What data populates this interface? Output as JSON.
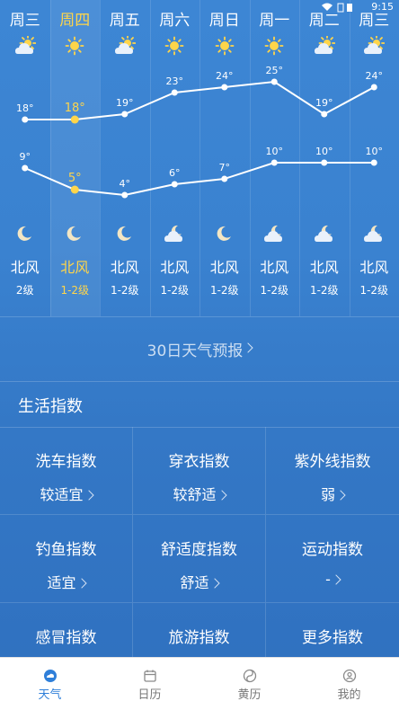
{
  "status": {
    "time": "9:15"
  },
  "days": [
    {
      "name": "周三",
      "day_icon": "cloudy-sun-icon",
      "high": "18°",
      "low": "9°",
      "night_icon": "moon-icon",
      "wind_dir": "北风",
      "wind_level": "2级",
      "today": false
    },
    {
      "name": "周四",
      "day_icon": "sun-icon",
      "high": "18°",
      "low": "5°",
      "night_icon": "moon-icon",
      "wind_dir": "北风",
      "wind_level": "1-2级",
      "today": true
    },
    {
      "name": "周五",
      "day_icon": "cloudy-sun-icon",
      "high": "19°",
      "low": "4°",
      "night_icon": "moon-icon",
      "wind_dir": "北风",
      "wind_level": "1-2级",
      "today": false
    },
    {
      "name": "周六",
      "day_icon": "sun-icon",
      "high": "23°",
      "low": "6°",
      "night_icon": "cloudy-moon-icon",
      "wind_dir": "北风",
      "wind_level": "1-2级",
      "today": false
    },
    {
      "name": "周日",
      "day_icon": "sun-icon",
      "high": "24°",
      "low": "7°",
      "night_icon": "moon-icon",
      "wind_dir": "北风",
      "wind_level": "1-2级",
      "today": false
    },
    {
      "name": "周一",
      "day_icon": "sun-icon",
      "high": "25°",
      "low": "10°",
      "night_icon": "cloudy-moon-icon",
      "wind_dir": "北风",
      "wind_level": "1-2级",
      "today": false
    },
    {
      "name": "周二",
      "day_icon": "cloudy-sun-icon",
      "high": "19°",
      "low": "10°",
      "night_icon": "cloudy-moon-icon",
      "wind_dir": "北风",
      "wind_level": "1-2级",
      "today": false
    },
    {
      "name": "周三",
      "day_icon": "cloudy-sun-icon",
      "high": "24°",
      "low": "10°",
      "night_icon": "cloudy-moon-icon",
      "wind_dir": "北风",
      "wind_level": "1-2级",
      "today": false
    }
  ],
  "chart_data": {
    "type": "line",
    "categories": [
      "周三",
      "周四",
      "周五",
      "周六",
      "周日",
      "周一",
      "周二",
      "周三"
    ],
    "series": [
      {
        "values": [
          18,
          18,
          19,
          23,
          24,
          25,
          19,
          24
        ]
      },
      {
        "values": [
          9,
          5,
          4,
          6,
          7,
          10,
          10,
          10
        ]
      }
    ],
    "highlight_index": 1,
    "highlight_color": "#ffd54a",
    "line_color": "#ffffff"
  },
  "forecast30": {
    "label": "30日天气预报"
  },
  "life": {
    "title": "生活指数",
    "items": [
      {
        "name": "洗车指数",
        "value": "较适宜"
      },
      {
        "name": "穿衣指数",
        "value": "较舒适"
      },
      {
        "name": "紫外线指数",
        "value": "弱"
      },
      {
        "name": "钓鱼指数",
        "value": "适宜"
      },
      {
        "name": "舒适度指数",
        "value": "舒适"
      },
      {
        "name": "运动指数",
        "value": "-"
      },
      {
        "name": "感冒指数",
        "value": ""
      },
      {
        "name": "旅游指数",
        "value": ""
      },
      {
        "name": "更多指数",
        "value": ""
      }
    ]
  },
  "tabs": [
    {
      "label": "天气",
      "icon": "weather-icon",
      "active": true
    },
    {
      "label": "日历",
      "icon": "calendar-icon",
      "active": false
    },
    {
      "label": "黄历",
      "icon": "almanac-icon",
      "active": false
    },
    {
      "label": "我的",
      "icon": "profile-icon",
      "active": false
    }
  ],
  "colors": {
    "accent": "#2f7fd9",
    "highlight": "#ffd54a",
    "background": "#3a82d0"
  }
}
